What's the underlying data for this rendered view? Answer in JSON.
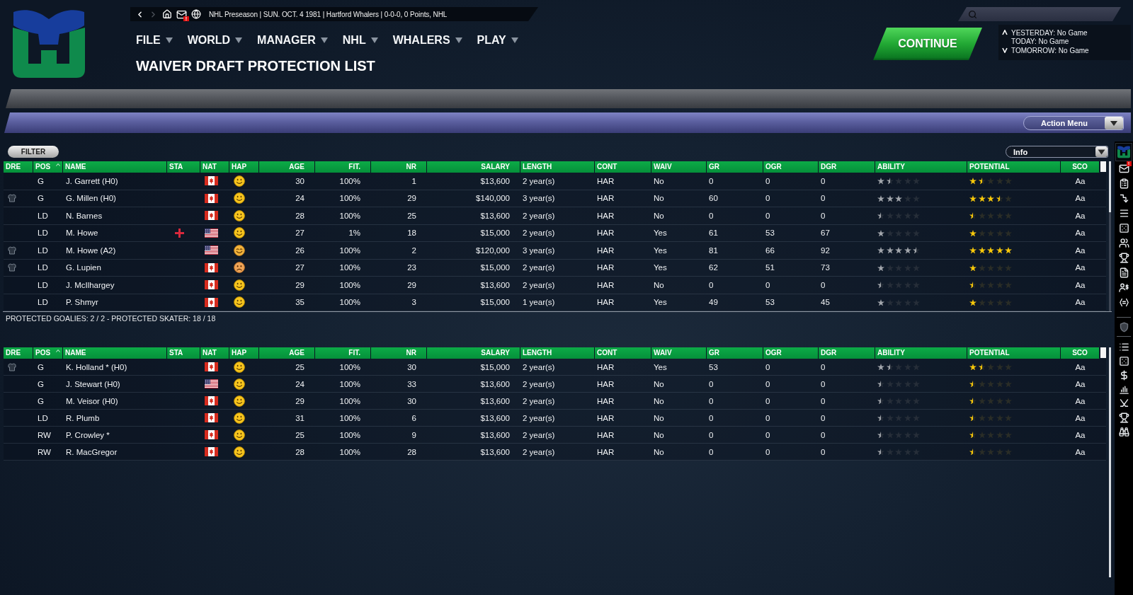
{
  "nav": {
    "status": "NHL Preseason | SUN. OCT. 4 1981 | Hartford Whalers | 0-0-0, 0 Points, NHL",
    "mail_badge": "!"
  },
  "menu": [
    "FILE",
    "WORLD",
    "MANAGER",
    "NHL",
    "WHALERS",
    "PLAY"
  ],
  "page_title": "WAIVER DRAFT PROTECTION LIST",
  "continue_button": "CONTINUE",
  "schedule": [
    "YESTERDAY: No Game",
    "TODAY: No Game",
    "TOMORROW: No Game"
  ],
  "action_menu": "Action Menu",
  "filter_button": "FILTER",
  "view_select": "Info",
  "tables": [
    {
      "columns": [
        {
          "label": "DRE",
          "sorted": false
        },
        {
          "label": "POS",
          "sorted": true
        },
        {
          "label": "NAME",
          "sorted": false
        },
        {
          "label": "STA",
          "sorted": false
        },
        {
          "label": "NAT",
          "sorted": false
        },
        {
          "label": "HAP",
          "sorted": false
        },
        {
          "label": "AGE",
          "sorted": false
        },
        {
          "label": "FIT.",
          "sorted": false
        },
        {
          "label": "NR",
          "sorted": false
        },
        {
          "label": "SALARY",
          "sorted": false
        },
        {
          "label": "LENGTH",
          "sorted": false
        },
        {
          "label": "CONT",
          "sorted": false
        },
        {
          "label": "WAIV",
          "sorted": false
        },
        {
          "label": "GR",
          "sorted": false
        },
        {
          "label": "OGR",
          "sorted": false
        },
        {
          "label": "DGR",
          "sorted": false
        },
        {
          "label": "ABILITY",
          "sorted": false
        },
        {
          "label": "POTENTIAL",
          "sorted": false
        },
        {
          "label": "SCO",
          "sorted": false
        }
      ],
      "rows": [
        {
          "dressed": false,
          "pos": "G",
          "name": "J. Garrett (H0)",
          "injured": false,
          "nat": {
            "kind": "canada"
          },
          "hap": {
            "kind": "happy"
          },
          "age": "30",
          "fit": "100%",
          "nr": "1",
          "salary": "$13,600",
          "length": "2 year(s)",
          "cont": "HAR",
          "waiv": "No",
          "gr": "0",
          "ogr": "0",
          "dgr": "0",
          "ability": {
            "stars": 1.5
          },
          "potential": {
            "stars": 1.5
          },
          "sco": "Aa"
        },
        {
          "dressed": true,
          "pos": "G",
          "name": "G. Millen (H0)",
          "injured": false,
          "nat": {
            "kind": "canada"
          },
          "hap": {
            "kind": "happy"
          },
          "age": "24",
          "fit": "100%",
          "nr": "29",
          "salary": "$140,000",
          "length": "3 year(s)",
          "cont": "HAR",
          "waiv": "No",
          "gr": "60",
          "ogr": "0",
          "dgr": "0",
          "ability": {
            "stars": 3
          },
          "potential": {
            "stars": 3.5
          },
          "sco": "Aa"
        },
        {
          "dressed": false,
          "pos": "LD",
          "name": "N. Barnes",
          "injured": false,
          "nat": {
            "kind": "canada"
          },
          "hap": {
            "kind": "happy"
          },
          "age": "28",
          "fit": "100%",
          "nr": "25",
          "salary": "$13,600",
          "length": "2 year(s)",
          "cont": "HAR",
          "waiv": "No",
          "gr": "0",
          "ogr": "0",
          "dgr": "0",
          "ability": {
            "stars": 0.5
          },
          "potential": {
            "stars": 0.5
          },
          "sco": "Aa"
        },
        {
          "dressed": false,
          "pos": "LD",
          "name": "M. Howe",
          "injured": true,
          "nat": {
            "kind": "usa"
          },
          "hap": {
            "kind": "happy"
          },
          "age": "27",
          "fit": "1%",
          "nr": "18",
          "salary": "$15,000",
          "length": "2 year(s)",
          "cont": "HAR",
          "waiv": "Yes",
          "gr": "61",
          "ogr": "53",
          "dgr": "67",
          "ability": {
            "stars": 1
          },
          "potential": {
            "stars": 1
          },
          "sco": "Aa"
        },
        {
          "dressed": true,
          "pos": "LD",
          "name": "M. Howe (A2)",
          "injured": false,
          "nat": {
            "kind": "usa"
          },
          "hap": {
            "kind": "pleased"
          },
          "age": "26",
          "fit": "100%",
          "nr": "2",
          "salary": "$120,000",
          "length": "3 year(s)",
          "cont": "HAR",
          "waiv": "Yes",
          "gr": "81",
          "ogr": "66",
          "dgr": "92",
          "ability": {
            "stars": 4.5
          },
          "potential": {
            "stars": 5
          },
          "sco": "Aa"
        },
        {
          "dressed": true,
          "pos": "LD",
          "name": "G. Lupien",
          "injured": false,
          "nat": {
            "kind": "canada"
          },
          "hap": {
            "kind": "unhappy"
          },
          "age": "27",
          "fit": "100%",
          "nr": "23",
          "salary": "$15,000",
          "length": "2 year(s)",
          "cont": "HAR",
          "waiv": "Yes",
          "gr": "62",
          "ogr": "51",
          "dgr": "73",
          "ability": {
            "stars": 1
          },
          "potential": {
            "stars": 1
          },
          "sco": "Aa"
        },
        {
          "dressed": false,
          "pos": "LD",
          "name": "J. McIlhargey",
          "injured": false,
          "nat": {
            "kind": "canada"
          },
          "hap": {
            "kind": "happy"
          },
          "age": "29",
          "fit": "100%",
          "nr": "29",
          "salary": "$13,600",
          "length": "2 year(s)",
          "cont": "HAR",
          "waiv": "No",
          "gr": "0",
          "ogr": "0",
          "dgr": "0",
          "ability": {
            "stars": 0.5
          },
          "potential": {
            "stars": 0.5
          },
          "sco": "Aa"
        },
        {
          "dressed": false,
          "pos": "LD",
          "name": "P. Shmyr",
          "injured": false,
          "nat": {
            "kind": "canada"
          },
          "hap": {
            "kind": "happy"
          },
          "age": "35",
          "fit": "100%",
          "nr": "3",
          "salary": "$15,000",
          "length": "1 year(s)",
          "cont": "HAR",
          "waiv": "Yes",
          "gr": "49",
          "ogr": "53",
          "dgr": "45",
          "ability": {
            "stars": 1
          },
          "potential": {
            "stars": 1
          },
          "sco": "Aa"
        }
      ],
      "footer": "PROTECTED GOALIES: 2 / 2 - PROTECTED SKATER: 18 / 18"
    },
    {
      "columns": [
        {
          "label": "DRE",
          "sorted": false
        },
        {
          "label": "POS",
          "sorted": true
        },
        {
          "label": "NAME",
          "sorted": false
        },
        {
          "label": "STA",
          "sorted": false
        },
        {
          "label": "NAT",
          "sorted": false
        },
        {
          "label": "HAP",
          "sorted": false
        },
        {
          "label": "AGE",
          "sorted": false
        },
        {
          "label": "FIT.",
          "sorted": false
        },
        {
          "label": "NR",
          "sorted": false
        },
        {
          "label": "SALARY",
          "sorted": false
        },
        {
          "label": "LENGTH",
          "sorted": false
        },
        {
          "label": "CONT",
          "sorted": false
        },
        {
          "label": "WAIV",
          "sorted": false
        },
        {
          "label": "GR",
          "sorted": false
        },
        {
          "label": "OGR",
          "sorted": false
        },
        {
          "label": "DGR",
          "sorted": false
        },
        {
          "label": "ABILITY",
          "sorted": false
        },
        {
          "label": "POTENTIAL",
          "sorted": false
        },
        {
          "label": "SCO",
          "sorted": false
        }
      ],
      "rows": [
        {
          "dressed": true,
          "pos": "G",
          "name": "K. Holland * (H0)",
          "injured": false,
          "nat": {
            "kind": "canada"
          },
          "hap": {
            "kind": "happy"
          },
          "age": "25",
          "fit": "100%",
          "nr": "30",
          "salary": "$15,000",
          "length": "2 year(s)",
          "cont": "HAR",
          "waiv": "Yes",
          "gr": "53",
          "ogr": "0",
          "dgr": "0",
          "ability": {
            "stars": 1.5
          },
          "potential": {
            "stars": 1.5
          },
          "sco": "Aa"
        },
        {
          "dressed": false,
          "pos": "G",
          "name": "J. Stewart (H0)",
          "injured": false,
          "nat": {
            "kind": "usa"
          },
          "hap": {
            "kind": "happy"
          },
          "age": "24",
          "fit": "100%",
          "nr": "33",
          "salary": "$13,600",
          "length": "2 year(s)",
          "cont": "HAR",
          "waiv": "No",
          "gr": "0",
          "ogr": "0",
          "dgr": "0",
          "ability": {
            "stars": 0.5
          },
          "potential": {
            "stars": 0.5
          },
          "sco": "Aa"
        },
        {
          "dressed": false,
          "pos": "G",
          "name": "M. Veisor (H0)",
          "injured": false,
          "nat": {
            "kind": "canada"
          },
          "hap": {
            "kind": "happy"
          },
          "age": "29",
          "fit": "100%",
          "nr": "30",
          "salary": "$13,600",
          "length": "2 year(s)",
          "cont": "HAR",
          "waiv": "No",
          "gr": "0",
          "ogr": "0",
          "dgr": "0",
          "ability": {
            "stars": 0.5
          },
          "potential": {
            "stars": 0.5
          },
          "sco": "Aa"
        },
        {
          "dressed": false,
          "pos": "LD",
          "name": "R. Plumb",
          "injured": false,
          "nat": {
            "kind": "canada"
          },
          "hap": {
            "kind": "happy"
          },
          "age": "31",
          "fit": "100%",
          "nr": "6",
          "salary": "$13,600",
          "length": "2 year(s)",
          "cont": "HAR",
          "waiv": "No",
          "gr": "0",
          "ogr": "0",
          "dgr": "0",
          "ability": {
            "stars": 0.5
          },
          "potential": {
            "stars": 0.5
          },
          "sco": "Aa"
        },
        {
          "dressed": false,
          "pos": "RW",
          "name": "P. Crowley *",
          "injured": false,
          "nat": {
            "kind": "canada"
          },
          "hap": {
            "kind": "happy"
          },
          "age": "25",
          "fit": "100%",
          "nr": "9",
          "salary": "$13,600",
          "length": "2 year(s)",
          "cont": "HAR",
          "waiv": "No",
          "gr": "0",
          "ogr": "0",
          "dgr": "0",
          "ability": {
            "stars": 0.5
          },
          "potential": {
            "stars": 0.5
          },
          "sco": "Aa"
        },
        {
          "dressed": false,
          "pos": "RW",
          "name": "R. MacGregor",
          "injured": false,
          "nat": {
            "kind": "canada"
          },
          "hap": {
            "kind": "happy"
          },
          "age": "28",
          "fit": "100%",
          "nr": "28",
          "salary": "$13,600",
          "length": "2 year(s)",
          "cont": "HAR",
          "waiv": "No",
          "gr": "0",
          "ogr": "0",
          "dgr": "0",
          "ability": {
            "stars": 0.5
          },
          "potential": {
            "stars": 0.5
          },
          "sco": "Aa"
        }
      ]
    }
  ],
  "sidebar": {
    "mail_badge": "!"
  }
}
